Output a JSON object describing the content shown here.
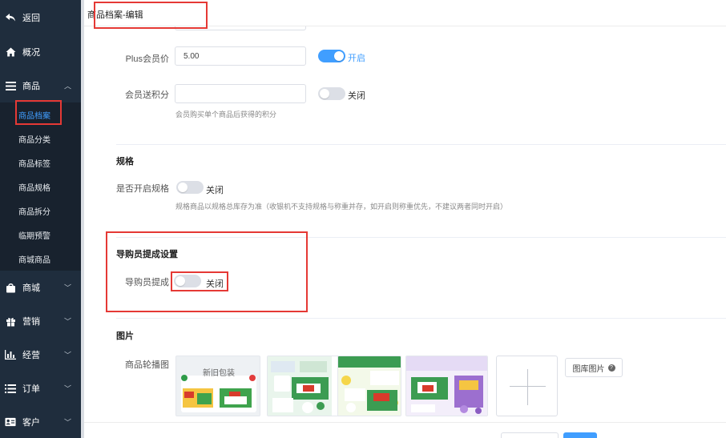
{
  "sidebar": {
    "back_label": "返回",
    "overview_label": "概况",
    "goods_label": "商品",
    "goods_sub": [
      "商品档案",
      "商品分类",
      "商品标签",
      "商品规格",
      "商品拆分",
      "临期预警",
      "商城商品"
    ],
    "mall_label": "商城",
    "marketing_label": "营销",
    "operation_label": "经营",
    "orders_label": "订单",
    "customers_label": "客户"
  },
  "header": {
    "title": "商品档案-编辑"
  },
  "form": {
    "plus_price_label": "Plus会员价",
    "plus_price_value": "5.00",
    "plus_toggle_label": "开启",
    "points_label": "会员送积分",
    "points_value": "",
    "points_toggle_label": "关闭",
    "points_hint": "会员购买单个商品后获得的积分",
    "spec_section": "规格",
    "spec_label": "是否开启规格",
    "spec_toggle_label": "关闭",
    "spec_hint": "规格商品以规格总库存为准（收银机不支持规格与称重并存，如开启则称重优先，不建议两者同时开启）",
    "guide_section": "导购员提成设置",
    "guide_label": "导购员提成",
    "guide_toggle_label": "关闭",
    "image_section": "图片",
    "carousel_label": "商品轮播图",
    "thumb1_text": "新旧包装",
    "library_button": "图库图片"
  },
  "colors": {
    "accent": "#409eff",
    "sidebar_bg": "#1f2d3d",
    "highlight": "#e53935"
  }
}
